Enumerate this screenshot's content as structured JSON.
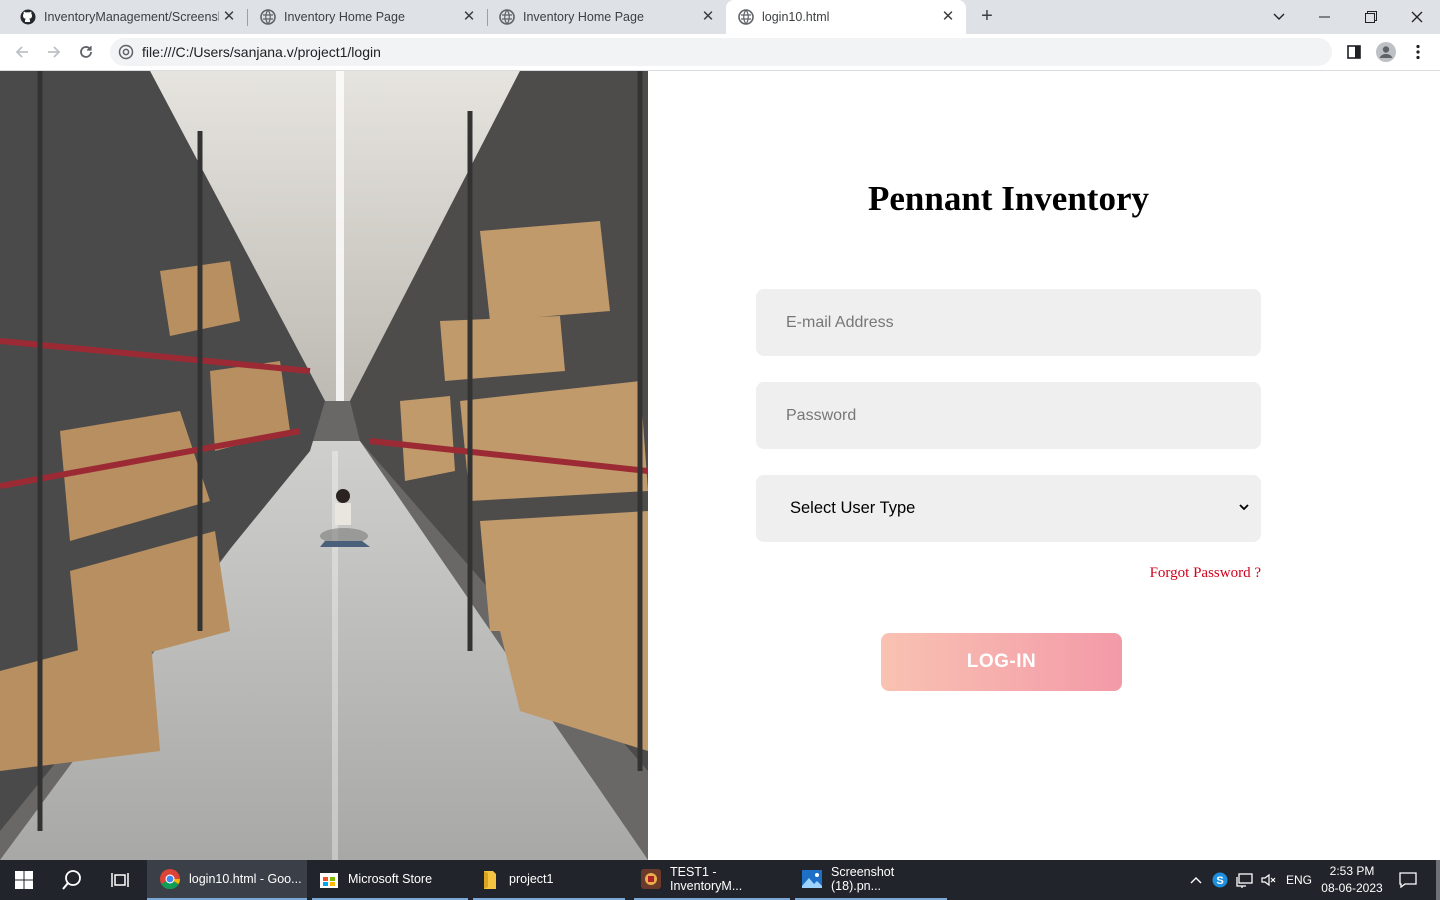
{
  "browser": {
    "tabs": [
      {
        "title": "InventoryManagement/Screensh",
        "icon": "github-icon",
        "active": false
      },
      {
        "title": "Inventory Home Page",
        "icon": "globe-icon",
        "active": false
      },
      {
        "title": "Inventory Home Page",
        "icon": "globe-icon",
        "active": false
      },
      {
        "title": "login10.html",
        "icon": "globe-icon",
        "active": true
      }
    ],
    "url": "file:///C:/Users/sanjana.v/project1/login"
  },
  "login": {
    "brand": "Pennant Inventory",
    "email_placeholder": "E-mail Address",
    "password_placeholder": "Password",
    "user_type_selected": "Select User Type",
    "forgot_password": "Forgot Password ?",
    "login_button": "LOG-IN",
    "button_gradient": [
      "#f9c2b2",
      "#f39aa8"
    ],
    "forgot_color": "#d0021b"
  },
  "taskbar": {
    "apps": [
      {
        "label": "login10.html - Goo...",
        "icon": "chrome-icon",
        "active": true
      },
      {
        "label": "Microsoft Store",
        "icon": "store-icon",
        "active": false
      },
      {
        "label": "project1",
        "icon": "folder-icon",
        "active": false
      },
      {
        "label": "TEST1 - InventoryM...",
        "icon": "app-icon",
        "active": false
      },
      {
        "label": "Screenshot (18).pn...",
        "icon": "photos-icon",
        "active": false
      }
    ],
    "language": "ENG",
    "time": "2:53 PM",
    "date": "08-06-2023"
  }
}
